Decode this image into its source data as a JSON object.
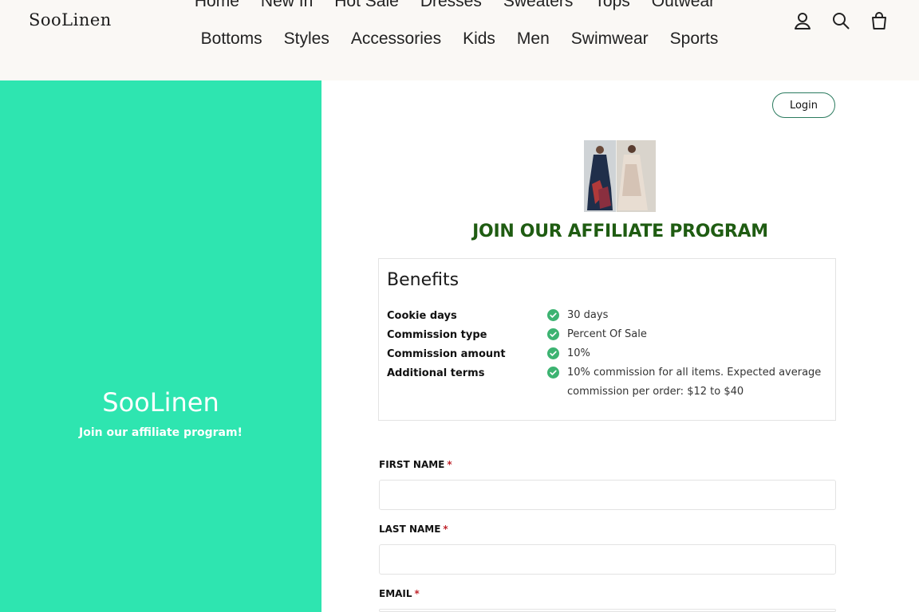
{
  "header": {
    "logo": "SooLinen",
    "nav_row1": [
      "Home",
      "New In",
      "Hot Sale",
      "Dresses",
      "Sweaters",
      "Tops",
      "Outwear"
    ],
    "nav_row2": [
      "Bottoms",
      "Styles",
      "Accessories",
      "Kids",
      "Men",
      "Swimwear",
      "Sports"
    ],
    "icons": [
      "account-icon",
      "search-icon",
      "cart-icon"
    ]
  },
  "left_panel": {
    "brand": "SooLinen",
    "tagline": "Join our affiliate program!",
    "background": "#2ee5b0"
  },
  "login_button": "Login",
  "title": "JOIN OUR AFFILIATE PROGRAM",
  "benefits": {
    "heading": "Benefits",
    "rows": [
      {
        "label": "Cookie days",
        "value": "30 days"
      },
      {
        "label": "Commission type",
        "value": "Percent Of Sale"
      },
      {
        "label": "Commission amount",
        "value": "10%"
      },
      {
        "label": "Additional terms",
        "value": "10% commission for all items. Expected average commission per order: $12 to $40"
      }
    ]
  },
  "form": {
    "first_name_label": "FIRST NAME",
    "last_name_label": "LAST NAME",
    "email_label": "EMAIL",
    "required_mark": "*"
  },
  "colors": {
    "accent": "#2ee5b0",
    "title_green": "#1f5c12",
    "check_green": "#3cb371",
    "required_red": "#c0262d"
  }
}
